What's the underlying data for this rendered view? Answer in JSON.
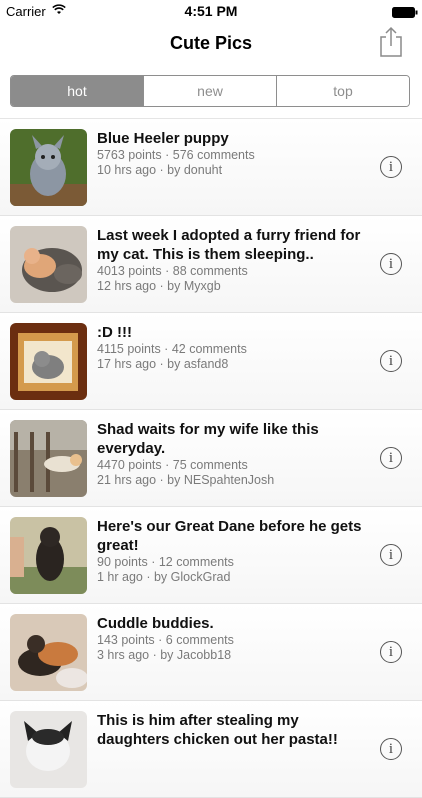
{
  "status_bar": {
    "carrier": "Carrier",
    "time": "4:51 PM"
  },
  "nav": {
    "title": "Cute Pics",
    "share_icon": "share-icon"
  },
  "segments": [
    {
      "label": "hot",
      "selected": true
    },
    {
      "label": "new",
      "selected": false
    },
    {
      "label": "top",
      "selected": false
    }
  ],
  "posts": [
    {
      "title": "Blue Heeler puppy",
      "stats": "5763 points · 576 comments",
      "posted": "10 hrs ago · by donuht"
    },
    {
      "title": "Last week I adopted a furry friend for my cat. This is them sleeping..",
      "stats": "4013 points · 88 comments",
      "posted": "12 hrs ago · by Myxgb"
    },
    {
      "title": ":D !!!",
      "stats": "4115 points · 42 comments",
      "posted": "17 hrs ago · by asfand8"
    },
    {
      "title": "Shad waits for my wife like this everyday.",
      "stats": "4470 points · 75 comments",
      "posted": "21 hrs ago · by NESpahtenJosh"
    },
    {
      "title": "Here's our Great Dane before he gets great!",
      "stats": "90 points · 12 comments",
      "posted": "1 hr ago · by GlockGrad"
    },
    {
      "title": "Cuddle buddies.",
      "stats": "143 points · 6 comments",
      "posted": "3 hrs ago · by Jacobb18"
    },
    {
      "title": "This is him after stealing my daughters chicken out her pasta!!",
      "stats": "",
      "posted": ""
    }
  ]
}
